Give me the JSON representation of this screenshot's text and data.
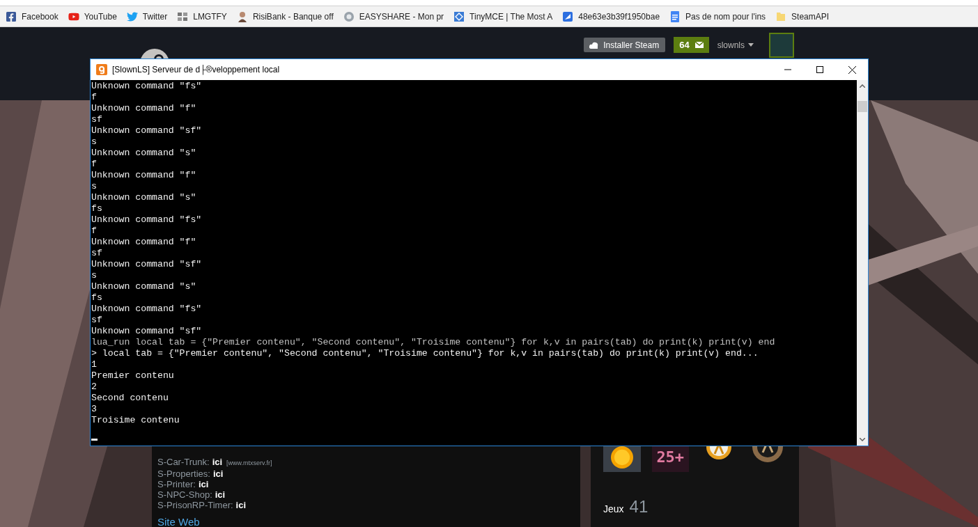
{
  "bookmarks": [
    {
      "kind": "facebook",
      "label": "Facebook"
    },
    {
      "kind": "youtube",
      "label": "YouTube"
    },
    {
      "kind": "twitter",
      "label": "Twitter"
    },
    {
      "kind": "lmgtfy",
      "label": "LMGTFY"
    },
    {
      "kind": "person",
      "label": "RisiBank - Banque off"
    },
    {
      "kind": "sync",
      "label": "EASYSHARE - Mon pr"
    },
    {
      "kind": "diamond",
      "label": "TinyMCE | The Most A"
    },
    {
      "kind": "arrow",
      "label": "48e63e3b39f1950bae"
    },
    {
      "kind": "doc",
      "label": "Pas de nom pour l'ins"
    },
    {
      "kind": "folder",
      "label": "SteamAPI"
    }
  ],
  "steam_header": {
    "install_button": "Installer Steam",
    "notifications": "64",
    "username": "slownls"
  },
  "plugins": [
    {
      "name": "S-Car-Trunk:",
      "link": "ici",
      "note": "[www.mtxserv.fr]"
    },
    {
      "name": "S-Properties:",
      "link": "ici"
    },
    {
      "name": "S-Printer:",
      "link": "ici"
    },
    {
      "name": "S-NPC-Shop:",
      "link": "ici"
    },
    {
      "name": "S-PrisonRP-Timer:",
      "link": "ici"
    }
  ],
  "site_heading": "Site Web",
  "badges": [
    {
      "kind": "coin"
    },
    {
      "kind": "years",
      "label": "25+"
    },
    {
      "kind": "lambda"
    },
    {
      "kind": "wreath"
    }
  ],
  "games": {
    "label": "Jeux",
    "count": "41"
  },
  "console_window": {
    "title": "[SlownLS] Serveur de d├®veloppement local",
    "lines": [
      {
        "kind": "out",
        "text": "Unknown command \"fs\""
      },
      {
        "kind": "out",
        "text": "f"
      },
      {
        "kind": "out",
        "text": "Unknown command \"f\""
      },
      {
        "kind": "out",
        "text": "sf"
      },
      {
        "kind": "out",
        "text": "Unknown command \"sf\""
      },
      {
        "kind": "out",
        "text": "s"
      },
      {
        "kind": "out",
        "text": "Unknown command \"s\""
      },
      {
        "kind": "out",
        "text": "f"
      },
      {
        "kind": "out",
        "text": "Unknown command \"f\""
      },
      {
        "kind": "out",
        "text": "s"
      },
      {
        "kind": "out",
        "text": "Unknown command \"s\""
      },
      {
        "kind": "out",
        "text": "fs"
      },
      {
        "kind": "out",
        "text": "Unknown command \"fs\""
      },
      {
        "kind": "out",
        "text": "f"
      },
      {
        "kind": "out",
        "text": "Unknown command \"f\""
      },
      {
        "kind": "out",
        "text": "sf"
      },
      {
        "kind": "out",
        "text": "Unknown command \"sf\""
      },
      {
        "kind": "out",
        "text": "s"
      },
      {
        "kind": "out",
        "text": "Unknown command \"s\""
      },
      {
        "kind": "out",
        "text": "fs"
      },
      {
        "kind": "out",
        "text": "Unknown command \"fs\""
      },
      {
        "kind": "out",
        "text": "sf"
      },
      {
        "kind": "out",
        "text": "Unknown command \"sf\""
      },
      {
        "kind": "echo",
        "text": "lua_run local tab = {\"Premier contenu\", \"Second contenu\", \"Troisime contenu\"} for k,v in pairs(tab) do print(k) print(v) end"
      },
      {
        "kind": "out",
        "text": "> local tab = {\"Premier contenu\", \"Second contenu\", \"Troisime contenu\"} for k,v in pairs(tab) do print(k) print(v) end..."
      },
      {
        "kind": "out",
        "text": "1"
      },
      {
        "kind": "out",
        "text": "Premier contenu"
      },
      {
        "kind": "out",
        "text": "2"
      },
      {
        "kind": "out",
        "text": "Second contenu"
      },
      {
        "kind": "out",
        "text": "3"
      },
      {
        "kind": "out",
        "text": "Troisime contenu"
      }
    ]
  }
}
